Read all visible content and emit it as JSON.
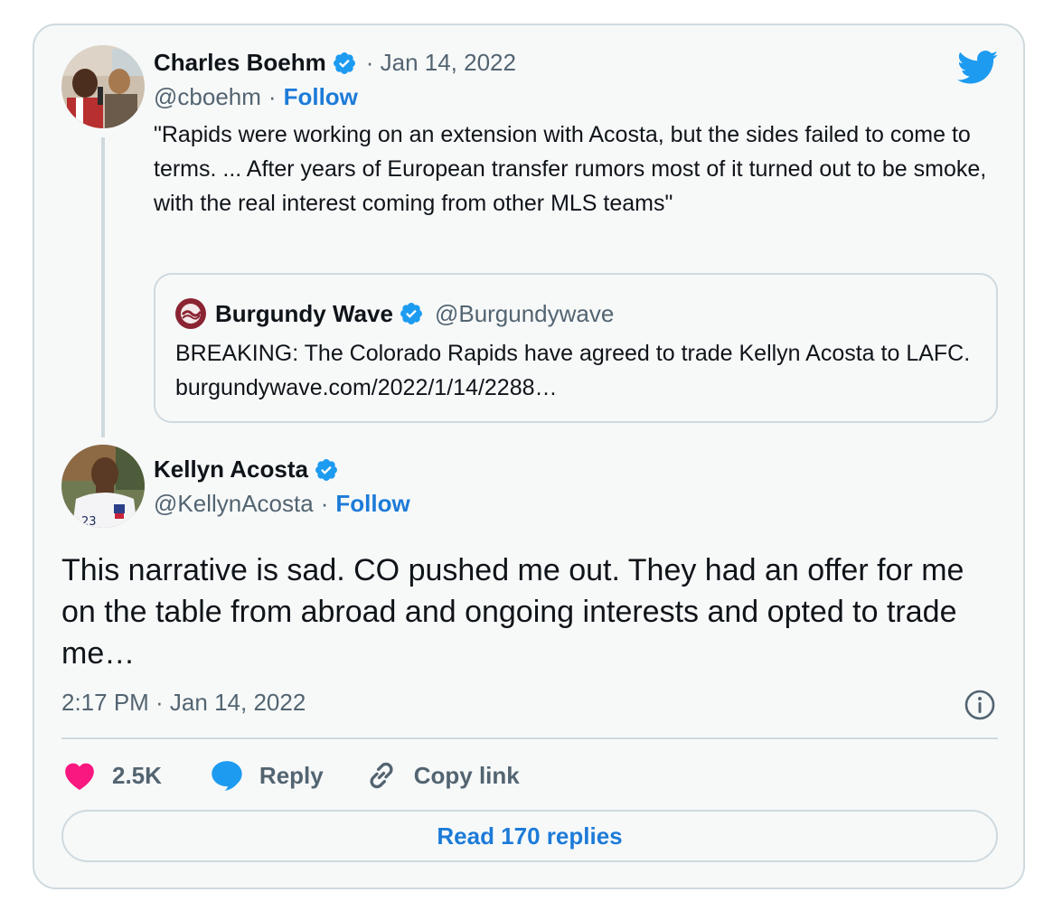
{
  "quoted_tweet": {
    "author_name": "Charles Boehm",
    "date": "· Jan 14, 2022",
    "handle": "@cboehm",
    "separator": "·",
    "follow_label": "Follow",
    "text": "\"Rapids were working on an extension with Acosta, but the sides failed to come to terms. ... After years of European transfer rumors most of it turned out to be smoke, with the real interest coming from other MLS teams\"",
    "embedded": {
      "name": "Burgundy Wave",
      "handle": "@Burgundywave",
      "text": "BREAKING: The Colorado Rapids have agreed to trade Kellyn Acosta to LAFC. burgundywave.com/2022/1/14/2288…"
    }
  },
  "main_tweet": {
    "author_name": "Kellyn Acosta",
    "handle": "@KellynAcosta",
    "separator": "·",
    "follow_label": "Follow",
    "text": "This narrative is sad. CO pushed me out. They had an offer for me on the table from abroad and ongoing interests and opted to trade me…",
    "timestamp": "2:17 PM · Jan 14, 2022"
  },
  "actions": {
    "like_count": "2.5K",
    "reply_label": "Reply",
    "copy_link_label": "Copy link",
    "read_replies_label": "Read 170 replies"
  },
  "icons": {
    "brand": "twitter-bird-icon",
    "verified": "verified-badge-icon",
    "info": "info-icon",
    "like": "heart-icon",
    "reply": "speech-bubble-icon",
    "copy": "link-icon"
  },
  "colors": {
    "twitter_blue": "#1d9bf0",
    "link_blue": "#1d7bd8",
    "like_pink": "#f91880",
    "muted_text": "#536471",
    "border": "#cfd9de",
    "card_bg": "#f7f9f9"
  }
}
